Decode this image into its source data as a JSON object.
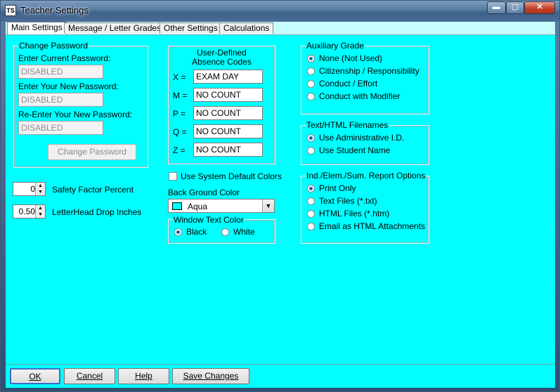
{
  "window": {
    "title": "Teacher Settings",
    "icon_text": "TS",
    "min_glyph": "▬",
    "max_glyph": "▢",
    "close_glyph": "✕"
  },
  "tabs": [
    {
      "label": "Main Settings"
    },
    {
      "label": "Message / Letter Grades"
    },
    {
      "label": "Other Settings"
    },
    {
      "label": "Calculations"
    }
  ],
  "password": {
    "group_title": "Change Password",
    "current_label": "Enter Current Password:",
    "current_value": "DISABLED",
    "new_label": "Enter Your New Password:",
    "new_value": "DISABLED",
    "reenter_label": "Re-Enter Your New Password:",
    "reenter_value": "DISABLED",
    "button": "Change Password"
  },
  "safety": {
    "value": "0",
    "label": "Safety Factor Percent"
  },
  "letterhead": {
    "value": "0.50",
    "label": "LetterHead Drop Inches"
  },
  "absence": {
    "title_line1": "User-Defined",
    "title_line2": "Absence Codes",
    "codes": [
      {
        "key": "X =",
        "value": "EXAM DAY"
      },
      {
        "key": "M =",
        "value": "NO COUNT"
      },
      {
        "key": "P =",
        "value": "NO COUNT"
      },
      {
        "key": "Q =",
        "value": "NO COUNT"
      },
      {
        "key": "Z =",
        "value": "NO COUNT"
      }
    ]
  },
  "colors": {
    "use_default_label": "Use System Default Colors",
    "use_default_checked": false,
    "back_label": "Back Ground Color",
    "back_value": "Aqua",
    "back_hex": "#00FFFF",
    "window_text_title": "Window Text Color",
    "black_label": "Black",
    "white_label": "White",
    "selected": "Black"
  },
  "auxiliary": {
    "title": "Auxiliary Grade",
    "options": [
      "None (Not Used)",
      "Citizenship / Responsibility",
      "Conduct / Effort",
      "Conduct with Modifier"
    ],
    "selected": 0
  },
  "filenames": {
    "title": "Text/HTML Filenames",
    "options": [
      "Use Administrative I.D.",
      "Use Student Name"
    ],
    "selected": 0
  },
  "report": {
    "title": "Ind./Elem./Sum. Report Options",
    "options": [
      "Print Only",
      "Text Files (*.txt)",
      "HTML Files (*.htm)",
      "Email as HTML Attachments"
    ],
    "selected": 0
  },
  "footer": {
    "ok": "OK",
    "cancel": "Cancel",
    "help": "Help",
    "save": "Save Changes"
  }
}
